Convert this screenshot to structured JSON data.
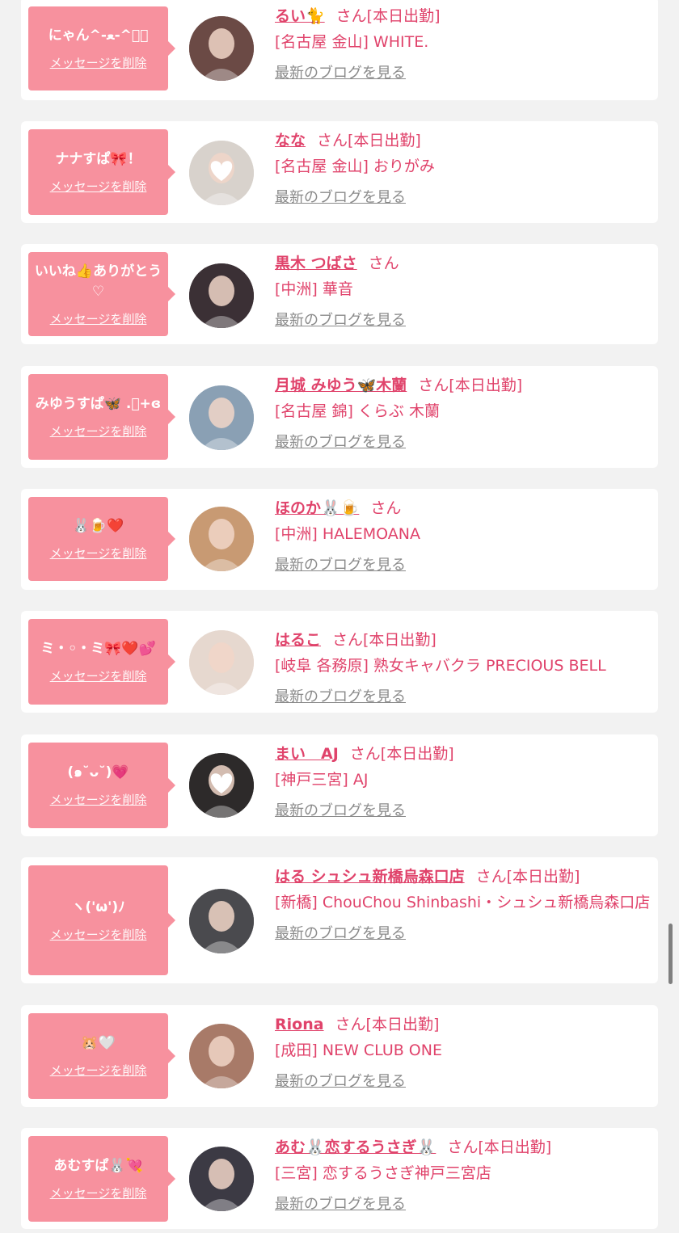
{
  "delete_label": "メッセージを削除",
  "blog_label": "最新のブログを見る",
  "entries": [
    {
      "message": "にゃん^-ﻌ-^ฅ゙",
      "name": "るい🐈",
      "suffix": "さん[本日出勤]",
      "shop": "[名古屋 金山] WHITE.",
      "avatar_color": "#6b4a45",
      "avatar_icon": "avatar-photo"
    },
    {
      "message": "ナナすぱ🎀！",
      "name": "なな",
      "suffix": "さん[本日出勤]",
      "shop": "[名古屋 金山] おりがみ",
      "avatar_color": "#d8d2cc",
      "avatar_icon": "avatar-photo-heart-blur"
    },
    {
      "message": "いいね👍ありがとう♡",
      "name": "黒木 つばさ",
      "suffix": "さん",
      "shop": "[中洲] 華音",
      "avatar_color": "#3b3035",
      "avatar_icon": "avatar-photo"
    },
    {
      "message": "みゆうすぱ🦋 .ﾟ+ɞ",
      "name": "月城 みゆう🦋木蘭",
      "suffix": "さん[本日出勤]",
      "shop": "[名古屋 錦] くらぶ 木蘭",
      "avatar_color": "#8aa0b4",
      "avatar_icon": "avatar-photo"
    },
    {
      "message": "🐰🍺❤️",
      "name": "ほのか🐰🍺",
      "suffix": "さん",
      "shop": "[中洲] HALEMOANA",
      "avatar_color": "#c89a73",
      "avatar_icon": "avatar-photo"
    },
    {
      "message": "ミ・◦・ミ🎀❤️💕",
      "name": "はるこ",
      "suffix": "さん[本日出勤]",
      "shop": "[岐阜 各務原]  熟女キャバクラ PRECIOUS BELL",
      "avatar_color": "#e6d8cf",
      "avatar_icon": "avatar-photo"
    },
    {
      "message": "(๑˘ᴗ˘)💗",
      "name": "まい　AJ",
      "suffix": "さん[本日出勤]",
      "shop": "[神戸三宮] AJ",
      "avatar_color": "#2d2a2a",
      "avatar_icon": "avatar-photo-heart-blur"
    },
    {
      "message": "ヽ('ω')ﾉ",
      "name": "はる シュシュ新橋烏森口店",
      "suffix": "さん[本日出勤]",
      "shop": "[新橋] ChouChou Shinbashi・シュシュ新橋烏森口店",
      "avatar_color": "#4a4a4e",
      "avatar_icon": "avatar-photo"
    },
    {
      "message": "🐹🤍",
      "name": "Riona",
      "suffix": "さん[本日出勤]",
      "shop": "[成田] NEW CLUB ONE",
      "avatar_color": "#a87a68",
      "avatar_icon": "avatar-photo"
    },
    {
      "message": "あむすぱ🐰💘",
      "name": "あむ🐰恋するうさぎ🐰",
      "suffix": "さん[本日出勤]",
      "shop": "[三宮] 恋するうさぎ神戸三宮店",
      "avatar_color": "#3c3a44",
      "avatar_icon": "avatar-photo"
    }
  ]
}
